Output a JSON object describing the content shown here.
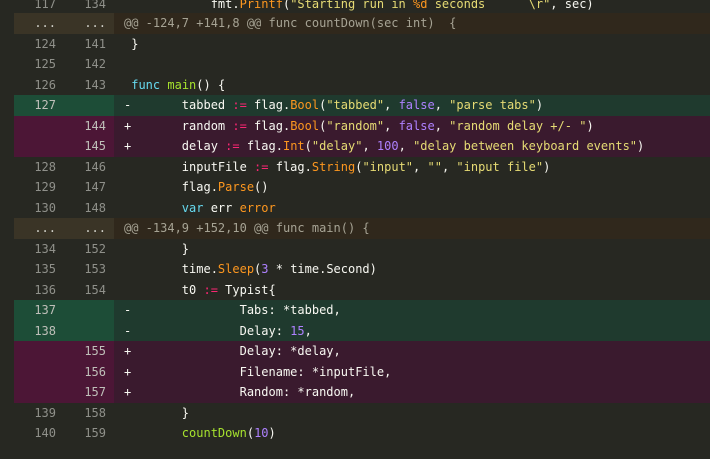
{
  "top": {
    "old": "117",
    "new": "134",
    "prefix": "            fmt.",
    "call": "Printf",
    "open": "(",
    "str1": "\"Starting run in ",
    "pct": "%d",
    "str2": " seconds      \\r\"",
    "tail": ", sec)"
  },
  "hunk1": {
    "old": "...",
    "new": "...",
    "text": "@@ -124,7 +141,8 @@ func countDown(sec int)  {"
  },
  "r124": {
    "old": "124",
    "new": "141",
    "text": " }"
  },
  "r125": {
    "old": "125",
    "new": "142",
    "text": ""
  },
  "r126": {
    "old": "126",
    "new": "143",
    "lead": " ",
    "kw": "func",
    "sp": " ",
    "fn": "main",
    "tail": "() {"
  },
  "r127": {
    "old": "127",
    "new": "",
    "lead": "-       tabbed ",
    "op": ":=",
    "mid": " flag.",
    "call": "Bool",
    "open": "(",
    "s1": "\"tabbed\"",
    "c1": ", ",
    "k": "false",
    "c2": ", ",
    "s2": "\"parse tabs\"",
    "close": ")"
  },
  "r144": {
    "old": "",
    "new": "144",
    "lead": "+       random ",
    "op": ":=",
    "mid": " flag.",
    "call": "Bool",
    "open": "(",
    "s1": "\"random\"",
    "c1": ", ",
    "k": "false",
    "c2": ", ",
    "s2": "\"random delay +/- \"",
    "close": ")"
  },
  "r145": {
    "old": "",
    "new": "145",
    "lead": "+       delay ",
    "op": ":=",
    "mid": " flag.",
    "call": "Int",
    "open": "(",
    "s1": "\"delay\"",
    "c1": ", ",
    "n": "100",
    "c2": ", ",
    "s2": "\"delay between keyboard events\"",
    "close": ")"
  },
  "r128": {
    "old": "128",
    "new": "146",
    "lead": "        inputFile ",
    "op": ":=",
    "mid": " flag.",
    "call": "String",
    "open": "(",
    "s1": "\"input\"",
    "c1": ", ",
    "s2": "\"\"",
    "c2": ", ",
    "s3": "\"input file\"",
    "close": ")"
  },
  "r129": {
    "old": "129",
    "new": "147",
    "lead": "        flag.",
    "call": "Parse",
    "tail": "()"
  },
  "r130": {
    "old": "130",
    "new": "148",
    "lead": "        ",
    "kw": "var",
    "mid": " err ",
    "type": "error"
  },
  "hunk2": {
    "old": "...",
    "new": "...",
    "text": "@@ -134,9 +152,10 @@ func main() {"
  },
  "r134": {
    "old": "134",
    "new": "152",
    "text": "        }"
  },
  "r135": {
    "old": "135",
    "new": "153",
    "lead": "        time.",
    "call": "Sleep",
    "open": "(",
    "n": "3",
    "tail": " * time.Second)"
  },
  "r136": {
    "old": "136",
    "new": "154",
    "lead": "        t0 ",
    "op": ":=",
    "tail": " Typist{"
  },
  "r137": {
    "old": "137",
    "new": "",
    "text": "-               Tabs: *tabbed,"
  },
  "r138": {
    "old": "138",
    "new": "",
    "lead": "-               Delay: ",
    "n": "15",
    "tail": ","
  },
  "r155": {
    "old": "",
    "new": "155",
    "text": "+               Delay: *delay,"
  },
  "r156": {
    "old": "",
    "new": "156",
    "text": "+               Filename: *inputFile,"
  },
  "r157": {
    "old": "",
    "new": "157",
    "text": "+               Random: *random,"
  },
  "r139": {
    "old": "139",
    "new": "158",
    "text": "        }"
  },
  "r140": {
    "old": "140",
    "new": "159",
    "lead": "        ",
    "call": "countDown",
    "open": "(",
    "n": "10",
    "tail": ")"
  }
}
